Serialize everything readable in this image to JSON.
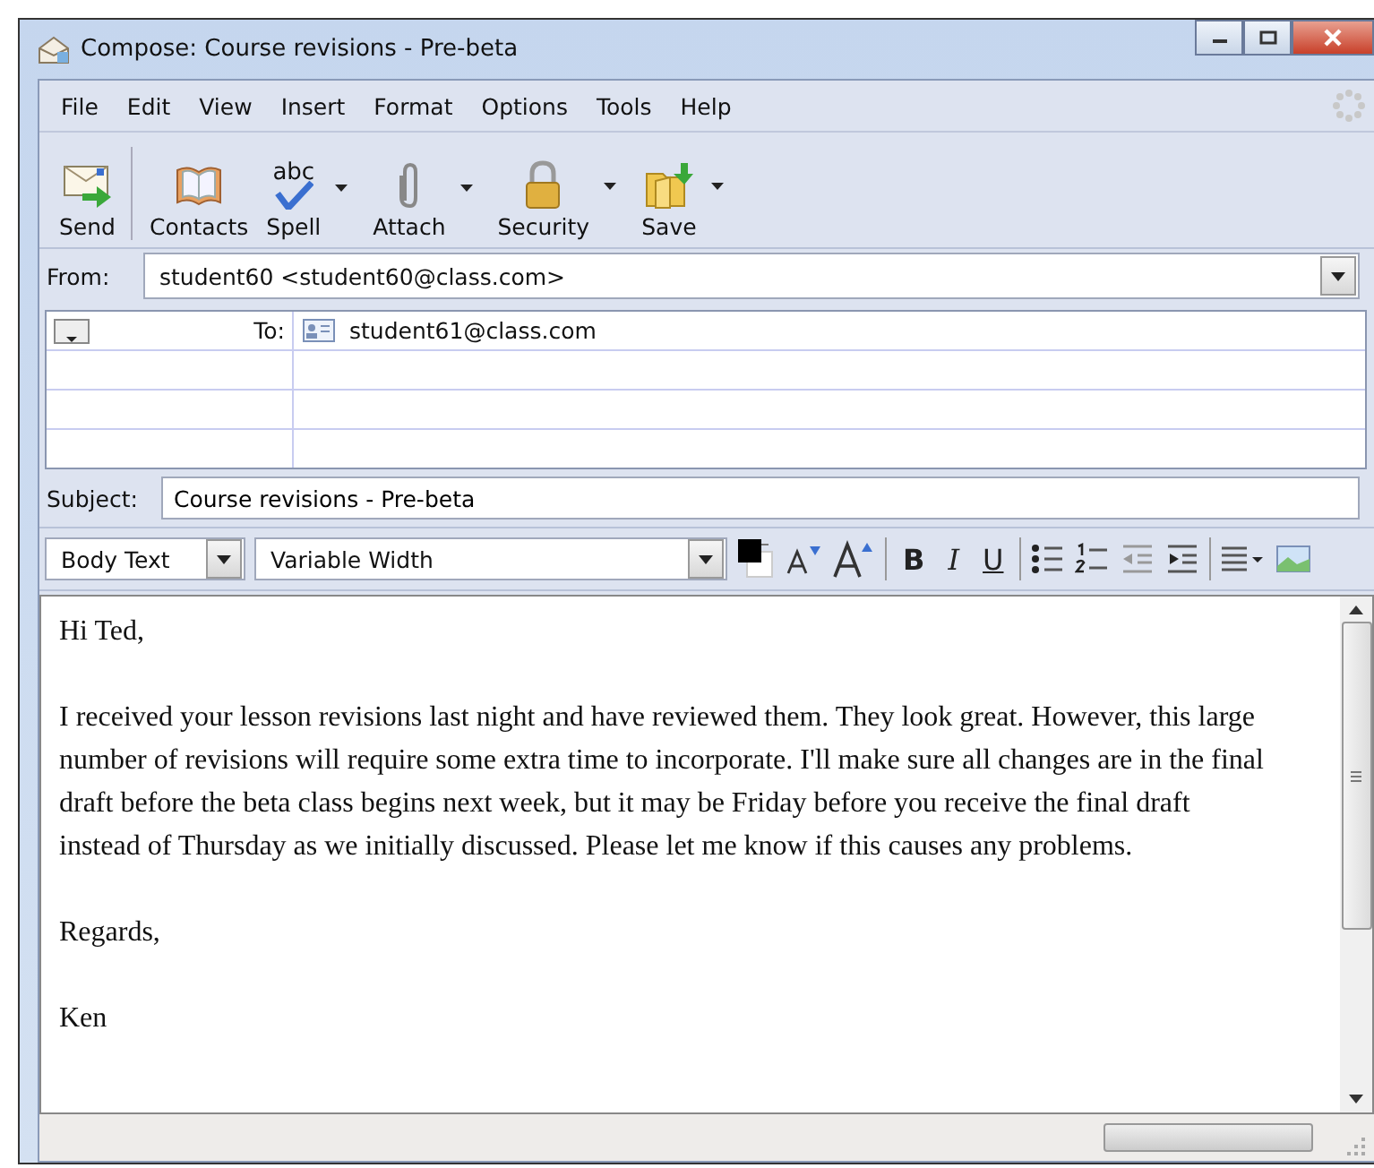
{
  "window": {
    "title": "Compose: Course revisions - Pre-beta"
  },
  "menu": [
    "File",
    "Edit",
    "View",
    "Insert",
    "Format",
    "Options",
    "Tools",
    "Help"
  ],
  "toolbar": [
    {
      "label": "Send",
      "dropdown": false
    },
    {
      "label": "Contacts",
      "dropdown": false
    },
    {
      "label": "Spell",
      "dropdown": true,
      "icon_text": "abc"
    },
    {
      "label": "Attach",
      "dropdown": true
    },
    {
      "label": "Security",
      "dropdown": true
    },
    {
      "label": "Save",
      "dropdown": true
    }
  ],
  "from": {
    "label": "From:",
    "value": "student60 <student60@class.com>"
  },
  "recipients": [
    {
      "type": "To:",
      "address": "student61@class.com"
    }
  ],
  "subject": {
    "label": "Subject:",
    "value": "Course revisions - Pre-beta"
  },
  "format_bar": {
    "paragraph_style": "Body Text",
    "font": "Variable Width",
    "bold": "B",
    "italic": "I",
    "underline": "U"
  },
  "body": [
    "Hi Ted,",
    "I received your lesson revisions last night and have reviewed them. They look great. However, this large number of revisions will require some extra time to incorporate. I'll make sure all changes are in the final draft before the beta class begins next week, but it may be Friday before you receive the final draft instead of Thursday as we initially discussed. Please let me know if this causes any problems.",
    "Regards,",
    "Ken"
  ]
}
